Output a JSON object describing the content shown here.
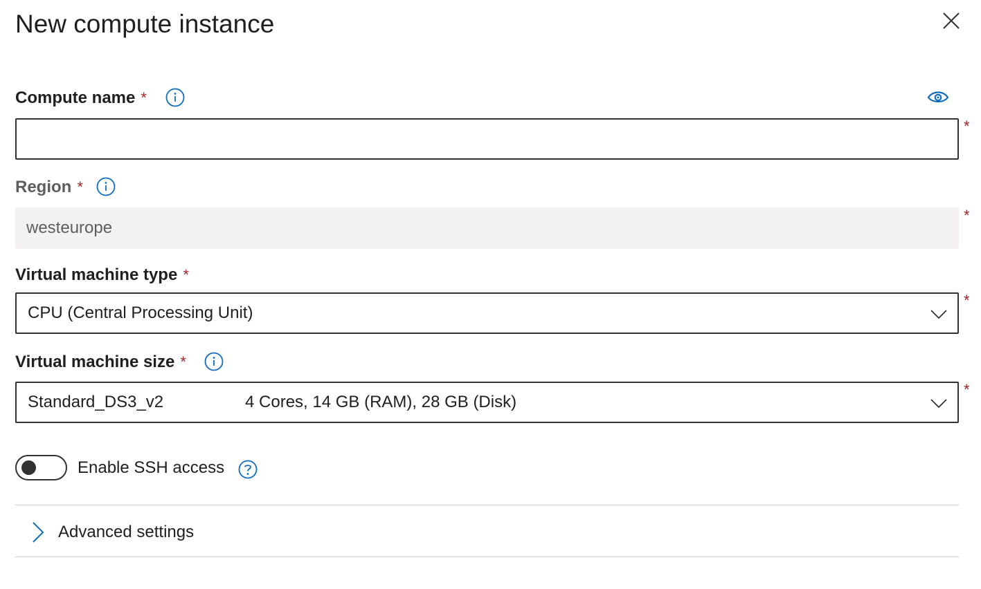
{
  "panel": {
    "title": "New compute instance"
  },
  "fields": {
    "compute_name": {
      "label": "Compute name",
      "required_mark": "*",
      "value": "",
      "side_required": "*"
    },
    "region": {
      "label": "Region",
      "required_mark": "*",
      "value": "westeurope",
      "side_required": "*"
    },
    "vm_type": {
      "label": "Virtual machine type",
      "required_mark": "*",
      "value": "CPU (Central Processing Unit)",
      "side_required": "*"
    },
    "vm_size": {
      "label": "Virtual machine size",
      "required_mark": "*",
      "value": "Standard_DS3_v2",
      "detail": "4 Cores, 14 GB (RAM), 28 GB (Disk)",
      "side_required": "*"
    }
  },
  "ssh": {
    "label": "Enable SSH access",
    "enabled": false
  },
  "advanced": {
    "label": "Advanced settings"
  },
  "icons": {
    "close": "close-icon",
    "info": "info-icon",
    "eye": "eye-icon",
    "chevron": "chevron-down-icon",
    "help": "question-icon",
    "expand": "chevron-right-icon"
  },
  "colors": {
    "accent": "#0f6cbd",
    "required": "#a4262c",
    "border": "#323130",
    "disabled_bg": "#f3f2f1"
  }
}
